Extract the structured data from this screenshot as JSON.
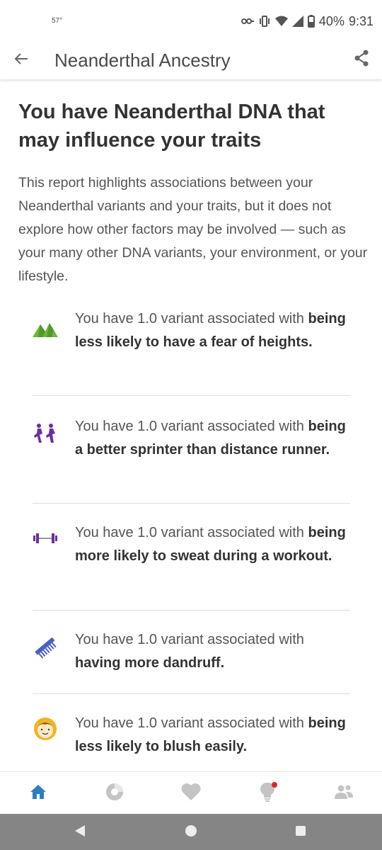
{
  "status_bar": {
    "temperature": "57°",
    "battery": "40%",
    "time": "9:31"
  },
  "app_bar": {
    "title": "Neanderthal Ancestry",
    "back_icon": "arrow-left-icon",
    "share_icon": "share-icon"
  },
  "content": {
    "headline": "You have Neanderthal DNA that may influence your traits",
    "intro": "This report highlights associations between your Neanderthal variants and your traits, but it does not explore how other factors may be involved — such as your many other DNA variants, your environment, or your lifestyle.",
    "traits": [
      {
        "icon": "mountains-icon",
        "prefix": "You have 1.0 variant associated with",
        "trait": "being less likely to have a fear of heights."
      },
      {
        "icon": "sprinters-icon",
        "prefix": "You have 1.0 variant associated with",
        "trait": "being a better sprinter than distance runner."
      },
      {
        "icon": "dumbbell-icon",
        "prefix": "You have 1.0 variant associated with",
        "trait": "being more likely to sweat during a workout."
      },
      {
        "icon": "comb-icon",
        "prefix": "You have 1.0 variant associated with",
        "trait": "having more dandruff."
      },
      {
        "icon": "blushing-face-icon",
        "prefix": "You have 1.0 variant associated with",
        "trait": "being less likely to blush easily."
      }
    ]
  },
  "bottom_nav": {
    "items": [
      "home-icon",
      "ancestry-chart-icon",
      "health-heart-icon",
      "lightbulb-icon",
      "family-icon"
    ],
    "active": "home-icon"
  },
  "colors": {
    "accent": "#2d7fc1",
    "mountain_green": "#6fb53e",
    "purple": "#6b2fa0",
    "comb_blue": "#4a5fc1",
    "face_yellow": "#f2b322",
    "notification_red": "#d9262b"
  }
}
